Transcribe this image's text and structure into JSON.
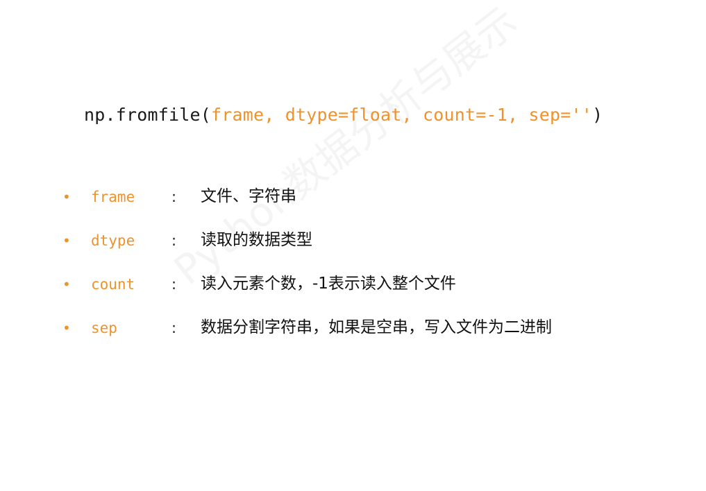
{
  "signature": {
    "prefix": "np.fromfile(",
    "args": "frame, dtype=float, count=-1, sep=''",
    "suffix": ")"
  },
  "params": [
    {
      "name": "frame",
      "colon": ":",
      "desc": "文件、字符串"
    },
    {
      "name": "dtype",
      "colon": ":",
      "desc": "读取的数据类型"
    },
    {
      "name": "count",
      "colon": ":",
      "desc": "读入元素个数，-1表示读入整个文件"
    },
    {
      "name": "sep",
      "colon": ":",
      "desc": "数据分割字符串，如果是空串，写入文件为二进制"
    }
  ],
  "bullet": "•",
  "watermark": "Python数据分析与展示",
  "colors": {
    "accent": "#f0922b",
    "text": "#1a1a1a"
  }
}
